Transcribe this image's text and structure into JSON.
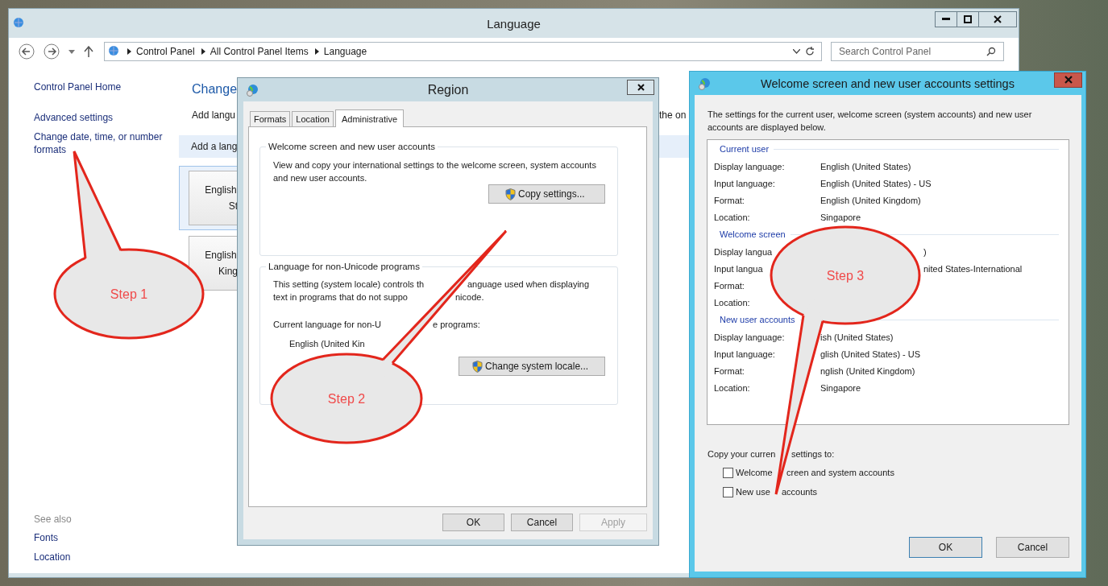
{
  "language_window": {
    "title": "Language",
    "breadcrumb": [
      "Control Panel",
      "All Control Panel Items",
      "Language"
    ],
    "search": {
      "placeholder": "Search Control Panel"
    },
    "sidebar": {
      "links": [
        "Control Panel Home",
        "Advanced settings",
        "Change date, time, or number formats"
      ],
      "see_also_heading": "See also",
      "see_also": [
        "Fonts",
        "Location"
      ]
    },
    "main": {
      "heading": "Change",
      "intro": "Add langu",
      "intro_end": "the on",
      "add_bar": "Add a lang",
      "language_tiles": [
        {
          "lines": [
            "English",
            "St"
          ],
          "selected": true
        },
        {
          "lines": [
            "English",
            "King"
          ],
          "selected": false
        }
      ]
    }
  },
  "region_dialog": {
    "title": "Region",
    "tabs": [
      {
        "label": "Formats",
        "selected": false
      },
      {
        "label": "Location",
        "selected": false
      },
      {
        "label": "Administrative",
        "selected": true
      }
    ],
    "welcome_group": {
      "legend": "Welcome screen and new user accounts",
      "description": "View and copy your international settings to the welcome screen, system accounts and new user accounts.",
      "button": "Copy settings..."
    },
    "locale_group": {
      "legend": "Language for non-Unicode programs",
      "lines": [
        [
          "This setting (system locale) controls th",
          "anguage used when displaying"
        ],
        [
          "text in programs that do not suppo",
          "nicode."
        ],
        [
          "Current language for non-U",
          "e programs:"
        ],
        [
          "English (United Kin"
        ]
      ],
      "button": "Change system locale..."
    },
    "buttons": [
      {
        "label": "OK",
        "disabled": false
      },
      {
        "label": "Cancel",
        "disabled": false
      },
      {
        "label": "Apply",
        "disabled": true
      }
    ]
  },
  "welcome_dialog": {
    "title": "Welcome screen and new user accounts settings",
    "intro": "The settings for the current user, welcome screen (system accounts) and new user accounts are displayed below.",
    "sections": [
      {
        "heading": "Current user",
        "rows": [
          {
            "label": "Display language:",
            "value": "English (United States)"
          },
          {
            "label": "Input language:",
            "value": "English (United States) - US"
          },
          {
            "label": "Format:",
            "value": "English (United Kingdom)"
          },
          {
            "label": "Location:",
            "value": "Singapore"
          }
        ]
      },
      {
        "heading": "Welcome screen",
        "rows": [
          {
            "label": "Display langua",
            "value": ")"
          },
          {
            "label": "Input langua",
            "value": "nited States-International"
          },
          {
            "label": "Format:"
          },
          {
            "label": "Location:"
          }
        ]
      },
      {
        "heading": "New user accounts",
        "rows": [
          {
            "label": "Display language:",
            "value": "ish (United States)"
          },
          {
            "label": "Input language:",
            "value": "glish (United States) - US"
          },
          {
            "label": "Format:",
            "value": "nglish (United Kingdom)"
          },
          {
            "label": "Location:",
            "value": "Singapore"
          }
        ]
      }
    ],
    "copy_to": [
      "Copy your curren",
      "settings to:"
    ],
    "checkboxes": [
      {
        "parts": [
          "Welcome",
          "creen and system accounts"
        ],
        "checked": false
      },
      {
        "parts": [
          "New use",
          "accounts"
        ],
        "checked": false
      }
    ],
    "buttons": [
      "OK",
      "Cancel"
    ]
  },
  "callouts": [
    {
      "label": "Step 1"
    },
    {
      "label": "Step 2"
    },
    {
      "label": "Step 3"
    }
  ]
}
